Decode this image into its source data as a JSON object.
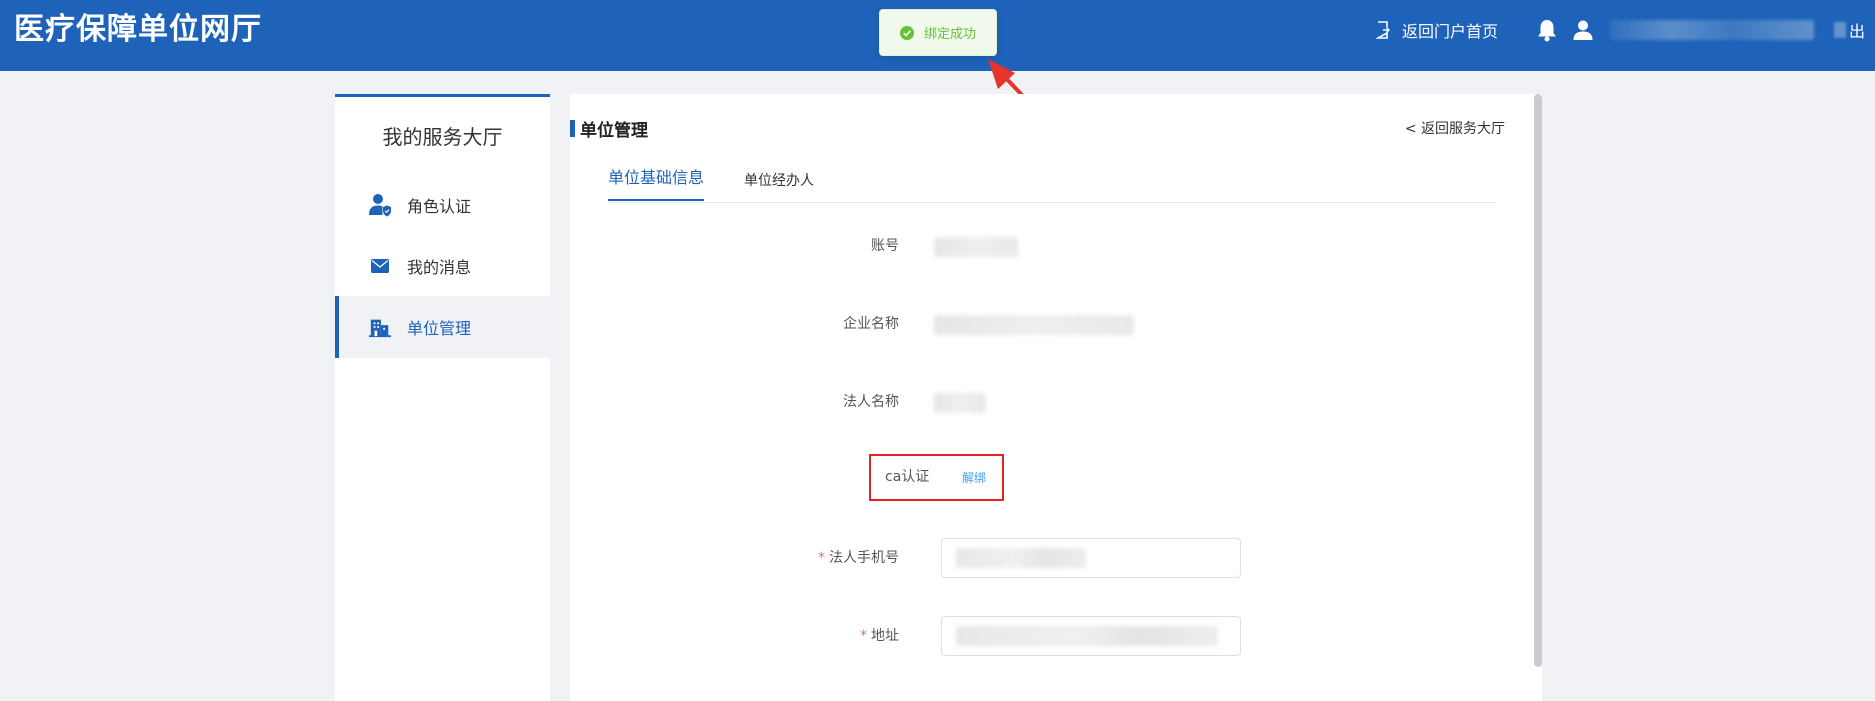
{
  "header": {
    "title": "医疗保障单位网厅",
    "portal_link": "返回门户首页",
    "logout_label": "出"
  },
  "toast": {
    "message": "绑定成功"
  },
  "sidebar": {
    "title": "我的服务大厅",
    "items": [
      {
        "label": "角色认证",
        "icon": "user-shield-icon"
      },
      {
        "label": "我的消息",
        "icon": "envelope-icon"
      },
      {
        "label": "单位管理",
        "icon": "building-icon",
        "active": true
      }
    ]
  },
  "main": {
    "title": "单位管理",
    "back_link": "< 返回服务大厅",
    "tabs": [
      {
        "label": "单位基础信息",
        "active": true
      },
      {
        "label": "单位经办人",
        "active": false
      }
    ],
    "form": {
      "account_label": "账号",
      "company_label": "企业名称",
      "legal_label": "法人名称",
      "ca_label": "ca认证",
      "ca_action": "解绑",
      "phone_label": "法人手机号",
      "address_label": "地址",
      "required_mark": "*"
    }
  },
  "colors": {
    "brand": "#1e63b9",
    "success": "#67c23a",
    "highlight": "#e02424",
    "link": "#409eff"
  }
}
